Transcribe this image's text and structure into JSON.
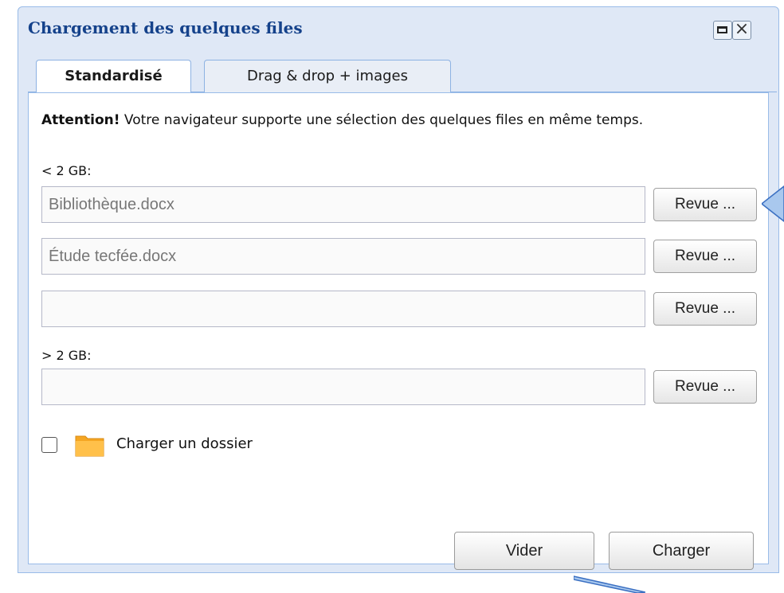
{
  "dialog": {
    "title": "Chargement des quelques files",
    "tabs": [
      {
        "label": "Standardisé",
        "active": true
      },
      {
        "label": "Drag & drop + images",
        "active": false
      }
    ]
  },
  "notice": {
    "strong": "Attention!",
    "text": " Votre navigateur supporte une sélection des quelques files en même temps."
  },
  "small_section": {
    "label": "< 2 GB:",
    "inputs": [
      {
        "value": "Bibliothèque.docx",
        "button": "Revue ..."
      },
      {
        "value": "Étude tecfée.docx",
        "button": "Revue ..."
      },
      {
        "value": "",
        "button": "Revue ..."
      }
    ]
  },
  "large_section": {
    "label": "> 2 GB:",
    "inputs": [
      {
        "value": "",
        "button": "Revue ..."
      }
    ]
  },
  "folder_option": {
    "checked": false,
    "label": "Charger un dossier"
  },
  "actions": {
    "clear_label": "Vider",
    "upload_label": "Charger"
  },
  "colors": {
    "title": "#15428b",
    "frame": "#dfe8f6",
    "border": "#99bbe8",
    "folder": "#f5a623"
  }
}
